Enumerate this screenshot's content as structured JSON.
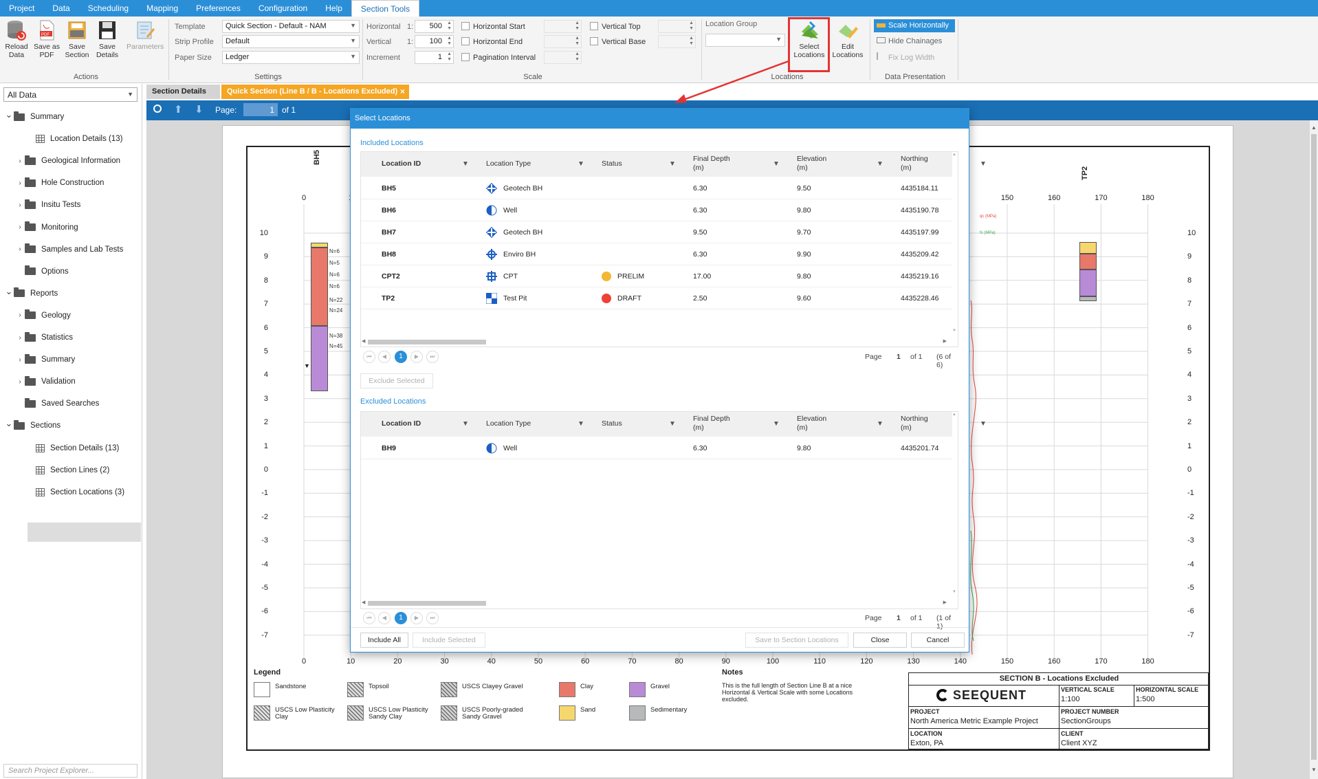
{
  "menu": [
    "Project",
    "Data",
    "Scheduling",
    "Mapping",
    "Preferences",
    "Configuration",
    "Help",
    "Section Tools"
  ],
  "ribbon": {
    "actions": {
      "title": "Actions",
      "buttons": [
        {
          "label": "Reload Data"
        },
        {
          "label": "Save as PDF"
        },
        {
          "label": "Save Section"
        },
        {
          "label": "Save Details"
        },
        {
          "label": "Parameters"
        }
      ]
    },
    "settings": {
      "title": "Settings",
      "template_label": "Template",
      "template_value": "Quick Section - Default - NAM",
      "strip_label": "Strip Profile",
      "strip_value": "Default",
      "paper_label": "Paper Size",
      "paper_value": "Ledger"
    },
    "scale": {
      "title": "Scale",
      "horizontal_label": "Horizontal",
      "horizontal_value": "500",
      "vertical_label": "Vertical",
      "vertical_value": "100",
      "ratio_prefix": "1:",
      "increment_label": "Increment",
      "increment_value": "1",
      "hstart": "Horizontal Start",
      "hend": "Horizontal End",
      "pagination": "Pagination Interval",
      "vtop": "Vertical Top",
      "vbase": "Vertical Base"
    },
    "locations": {
      "title": "Locations",
      "group_label": "Location Group",
      "select_label": "Select Locations",
      "edit_label": "Edit Locations"
    },
    "presentation": {
      "title": "Data Presentation",
      "scale_h": "Scale Horizontally",
      "hide_ch": "Hide Chainages",
      "fix_log": "Fix Log Width"
    }
  },
  "left": {
    "dropdown": "All Data",
    "tree": [
      {
        "label": "Summary",
        "type": "folder",
        "caret": "v",
        "indent": 0
      },
      {
        "label": "Location Details (13)",
        "type": "grid",
        "caret": "",
        "indent": 2
      },
      {
        "label": "Geological Information",
        "type": "folder",
        "caret": ">",
        "indent": 1
      },
      {
        "label": "Hole Construction",
        "type": "folder",
        "caret": ">",
        "indent": 1
      },
      {
        "label": "Insitu Tests",
        "type": "folder",
        "caret": ">",
        "indent": 1
      },
      {
        "label": "Monitoring",
        "type": "folder",
        "caret": ">",
        "indent": 1
      },
      {
        "label": "Samples and Lab Tests",
        "type": "folder",
        "caret": ">",
        "indent": 1
      },
      {
        "label": "Options",
        "type": "folder",
        "caret": "",
        "indent": 1
      },
      {
        "label": "Reports",
        "type": "folder",
        "caret": "v",
        "indent": 0
      },
      {
        "label": "Geology",
        "type": "folder",
        "caret": ">",
        "indent": 1
      },
      {
        "label": "Statistics",
        "type": "folder",
        "caret": ">",
        "indent": 1
      },
      {
        "label": "Summary",
        "type": "folder",
        "caret": ">",
        "indent": 1
      },
      {
        "label": "Validation",
        "type": "folder",
        "caret": ">",
        "indent": 1
      },
      {
        "label": "Saved Searches",
        "type": "folder",
        "caret": "",
        "indent": 1
      },
      {
        "label": "Sections",
        "type": "folder",
        "caret": "v",
        "indent": 0
      },
      {
        "label": "Section Details (13)",
        "type": "grid",
        "caret": "",
        "indent": 2
      },
      {
        "label": "Section Lines (2)",
        "type": "grid",
        "caret": "",
        "indent": 2
      },
      {
        "label": "Section Locations (3)",
        "type": "grid",
        "caret": "",
        "indent": 2
      }
    ],
    "search_placeholder": "Search Project Explorer..."
  },
  "tabs": {
    "details": "Section Details",
    "quick": "Quick Section (Line B / B - Locations Excluded)",
    "close": "×"
  },
  "nav": {
    "page_label": "Page:",
    "page_value": "1",
    "of": "of 1"
  },
  "section": {
    "bh_label": "BH5",
    "tp_label": "TP2",
    "y_ticks": [
      "10",
      "9",
      "8",
      "7",
      "6",
      "5",
      "4",
      "3",
      "2",
      "1",
      "0",
      "-1",
      "-2",
      "-3",
      "-4",
      "-5",
      "-6",
      "-7"
    ],
    "x_ticks": [
      "0",
      "10",
      "20",
      "30",
      "40",
      "50",
      "60",
      "70",
      "80",
      "90",
      "100",
      "110",
      "120",
      "130",
      "140",
      "150",
      "160",
      "170",
      "180"
    ],
    "top_ticks_left": [
      "0",
      "1"
    ],
    "top_ticks_right": [
      "150",
      "160",
      "170",
      "180"
    ],
    "spt": [
      "N=6",
      "N=5",
      "N=6",
      "N=6",
      "N=22",
      "N=24",
      "N=38",
      "N=45"
    ],
    "cpt_legend": [
      "qc (MPa)",
      "fs (MPa)"
    ]
  },
  "legend": {
    "title": "Legend",
    "items": [
      {
        "label": "Sandstone",
        "color": "#ffffff"
      },
      {
        "label": "Topsoil",
        "color": "#dcdcdc"
      },
      {
        "label": "USCS Clayey Gravel",
        "color": "#cfcfcf"
      },
      {
        "label": "Clay",
        "color": "#e8786a"
      },
      {
        "label": "Gravel",
        "color": "#b98ad6"
      },
      {
        "label": "USCS Low Plasticity Clay",
        "color": "#e0e0e0"
      },
      {
        "label": "USCS Low Plasticity Sandy Clay",
        "color": "#d6d6d6"
      },
      {
        "label": "USCS Poorly-graded Sandy Gravel",
        "color": "#d2d2d2"
      },
      {
        "label": "Sand",
        "color": "#f5d76e"
      },
      {
        "label": "Sedimentary",
        "color": "#b7b9bb"
      }
    ],
    "notes_title": "Notes",
    "notes": "This is the full length of Section Line B at a nice Horizontal & Vertical Scale with some Locations excluded."
  },
  "titleblock": {
    "title": "SECTION B - Locations Excluded",
    "logo": "SEEQUENT",
    "vs_label": "VERTICAL SCALE",
    "vs_value": "1:100",
    "hs_label": "HORIZONTAL SCALE",
    "hs_value": "1:500",
    "project_label": "PROJECT",
    "project_value": "North America Metric Example Project",
    "pn_label": "PROJECT NUMBER",
    "pn_value": "SectionGroups",
    "loc_label": "LOCATION",
    "loc_value": "Exton, PA",
    "client_label": "CLIENT",
    "client_value": "Client XYZ"
  },
  "dialog": {
    "title": "Select Locations",
    "included_title": "Included Locations",
    "excluded_title": "Excluded Locations",
    "columns": [
      {
        "label": "Location ID",
        "sub": ""
      },
      {
        "label": "Location Type",
        "sub": ""
      },
      {
        "label": "Status",
        "sub": ""
      },
      {
        "label": "Final Depth",
        "sub": "(m)"
      },
      {
        "label": "Elevation",
        "sub": "(m)"
      },
      {
        "label": "Northing",
        "sub": "(m)"
      }
    ],
    "included": [
      {
        "id": "BH5",
        "type": "Geotech BH",
        "icon": "geotech",
        "status": "",
        "status_color": "",
        "depth": "6.30",
        "elev": "9.50",
        "north": "4435184.11"
      },
      {
        "id": "BH6",
        "type": "Well",
        "icon": "well",
        "status": "",
        "status_color": "",
        "depth": "6.30",
        "elev": "9.80",
        "north": "4435190.78"
      },
      {
        "id": "BH7",
        "type": "Geotech BH",
        "icon": "geotech",
        "status": "",
        "status_color": "",
        "depth": "9.50",
        "elev": "9.70",
        "north": "4435197.99"
      },
      {
        "id": "BH8",
        "type": "Enviro BH",
        "icon": "enviro",
        "status": "",
        "status_color": "",
        "depth": "6.30",
        "elev": "9.90",
        "north": "4435209.42"
      },
      {
        "id": "CPT2",
        "type": "CPT",
        "icon": "cpt",
        "status": "PRELIM",
        "status_color": "#f3b731",
        "depth": "17.00",
        "elev": "9.80",
        "north": "4435219.16"
      },
      {
        "id": "TP2",
        "type": "Test Pit",
        "icon": "testpit",
        "status": "DRAFT",
        "status_color": "#ef4136",
        "depth": "2.50",
        "elev": "9.60",
        "north": "4435228.46"
      }
    ],
    "excluded": [
      {
        "id": "BH9",
        "type": "Well",
        "icon": "well",
        "status": "",
        "status_color": "",
        "depth": "6.30",
        "elev": "9.80",
        "north": "4435201.74"
      }
    ],
    "pager_inc": {
      "page": "Page",
      "num": "1",
      "of": "of 1",
      "count": "(6 of 6)"
    },
    "pager_exc": {
      "page": "Page",
      "num": "1",
      "of": "of 1",
      "count": "(1 of 1)"
    },
    "exclude_selected": "Exclude Selected",
    "include_all": "Include All",
    "include_selected": "Include Selected",
    "save_to": "Save to Section Locations",
    "close": "Close",
    "cancel": "Cancel"
  },
  "colors": {
    "accent": "#2b8fd8",
    "nav": "#1a6fb5",
    "tab_active": "#f5a623",
    "highlight": "#e53333"
  }
}
